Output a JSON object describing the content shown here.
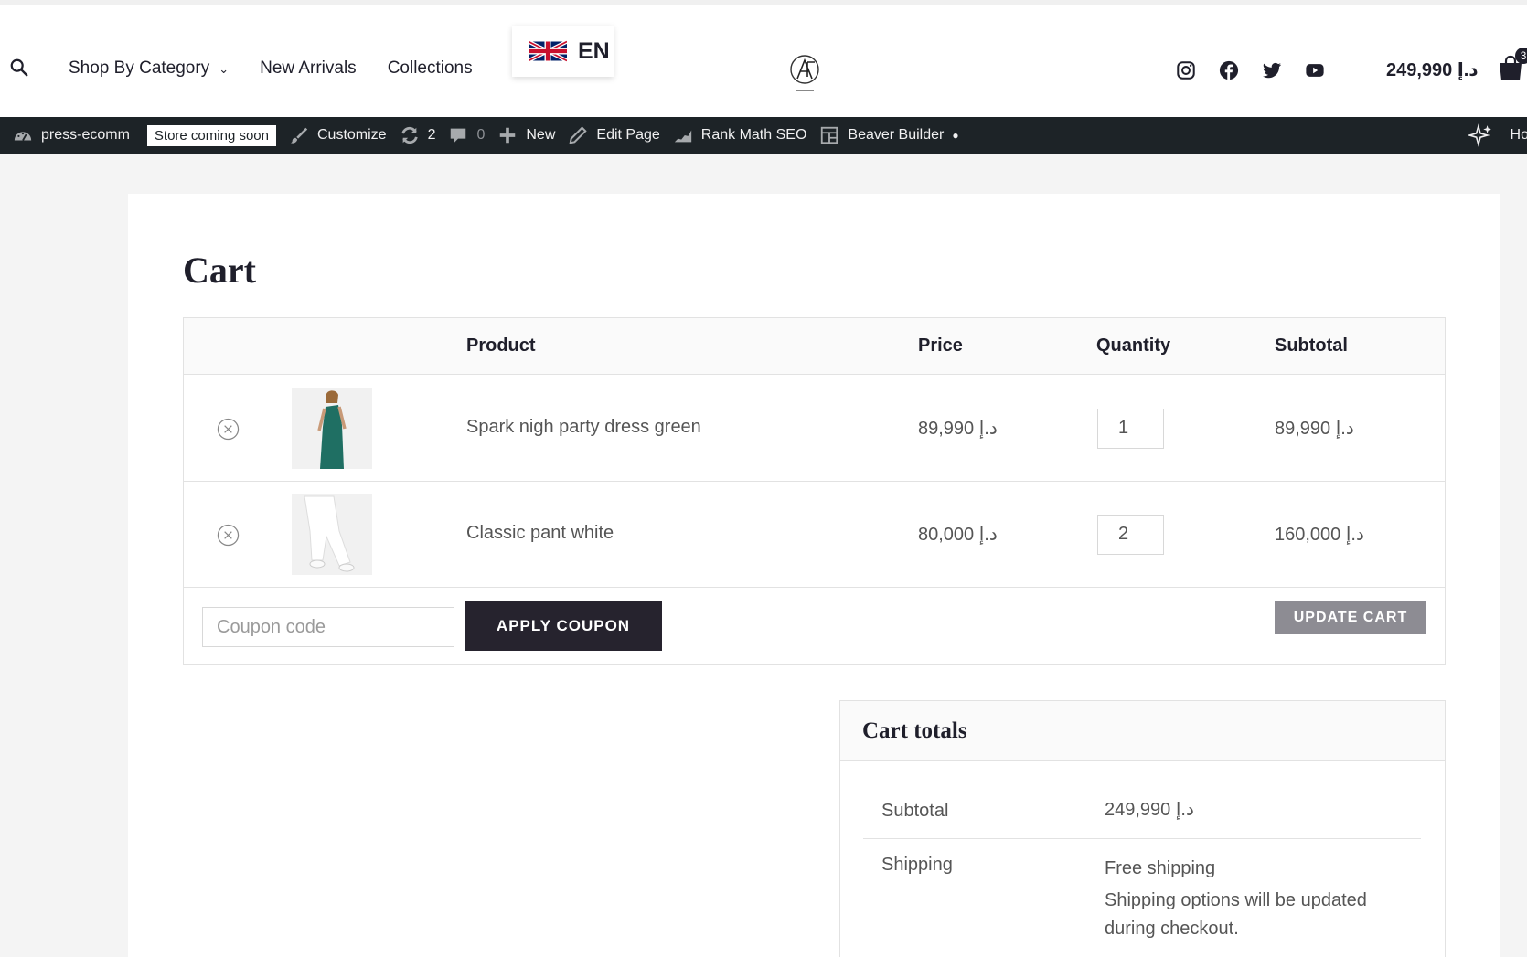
{
  "header": {
    "nav": {
      "shop_by_category": "Shop By Category",
      "new_arrivals": "New Arrivals",
      "collections": "Collections"
    },
    "language": "EN",
    "cart_total": "249,990 د.إ",
    "cart_count": "3"
  },
  "adminbar": {
    "site": "press-ecomm",
    "badge": "Store coming soon",
    "customize": "Customize",
    "updates": "2",
    "comments": "0",
    "new": "New",
    "edit_page": "Edit Page",
    "rank_math": "Rank Math SEO",
    "beaver": "Beaver Builder",
    "howdy": "Ho"
  },
  "page": {
    "title": "Cart"
  },
  "table": {
    "headers": {
      "product": "Product",
      "price": "Price",
      "quantity": "Quantity",
      "subtotal": "Subtotal"
    },
    "rows": [
      {
        "name": "Spark nigh party dress green",
        "price": "د.إ 89,990",
        "qty": "1",
        "subtotal": "د.إ 89,990"
      },
      {
        "name": "Classic pant white",
        "price": "د.إ 80,000",
        "qty": "2",
        "subtotal": "د.إ 160,000"
      }
    ],
    "coupon_placeholder": "Coupon code",
    "apply_label": "APPLY COUPON",
    "update_label": "UPDATE CART"
  },
  "totals": {
    "title": "Cart totals",
    "subtotal_label": "Subtotal",
    "subtotal_value": "د.إ 249,990",
    "shipping_label": "Shipping",
    "shipping_value": "Free shipping",
    "shipping_note": "Shipping options will be updated during checkout."
  },
  "colors": {
    "dark": "#26232e",
    "adminbar": "#1d2327",
    "update_button": "#8d8c93"
  }
}
